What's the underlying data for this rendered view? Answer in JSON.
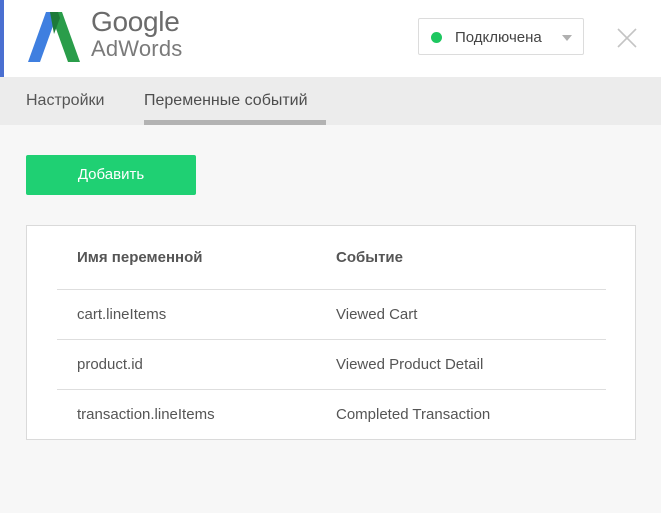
{
  "header": {
    "logo_google": "Google",
    "logo_adwords": "AdWords",
    "status": {
      "label": "Подключена",
      "color": "#1ec760"
    },
    "close_icon": "close-icon"
  },
  "tabs": [
    {
      "label": "Настройки",
      "active": false
    },
    {
      "label": "Переменные событий",
      "active": true
    }
  ],
  "actions": {
    "add_label": "Добавить",
    "add_color": "#1fd073"
  },
  "table": {
    "headers": [
      "Имя переменной",
      "Событие"
    ],
    "rows": [
      [
        "cart.lineItems",
        "Viewed Cart"
      ],
      [
        "product.id",
        "Viewed Product Detail"
      ],
      [
        "transaction.lineItems",
        "Completed Transaction"
      ]
    ]
  },
  "colors": {
    "accent": "#4a6fd1"
  }
}
